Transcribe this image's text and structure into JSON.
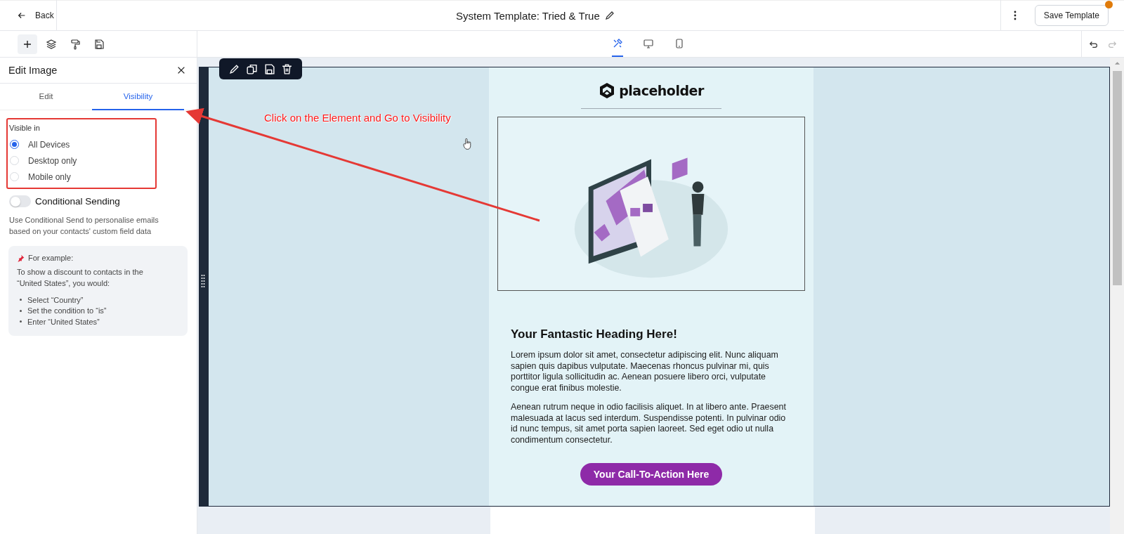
{
  "header": {
    "back": "Back",
    "title": "System Template: Tried & True",
    "save_button": "Save Template",
    "unsaved_changes": true
  },
  "toolbar": {
    "tools": [
      {
        "kind": "add",
        "selected": true
      },
      {
        "kind": "layers",
        "selected": false
      },
      {
        "kind": "paint",
        "selected": false
      },
      {
        "kind": "save",
        "selected": false
      }
    ],
    "views": [
      {
        "kind": "editor",
        "selected": true
      },
      {
        "kind": "desktop",
        "selected": false
      },
      {
        "kind": "mobile",
        "selected": false
      }
    ],
    "history": [
      {
        "kind": "undo",
        "disabled": false
      },
      {
        "kind": "redo",
        "disabled": true
      }
    ]
  },
  "panel": {
    "title": "Edit Image",
    "tabs": [
      {
        "label": "Edit",
        "selected": false
      },
      {
        "label": "Visibility",
        "selected": true
      }
    ],
    "visible_in": {
      "label": "Visible in",
      "options": [
        {
          "label": "All Devices",
          "selected": true
        },
        {
          "label": "Desktop only",
          "selected": false
        },
        {
          "label": "Mobile only",
          "selected": false
        }
      ]
    },
    "conditional": {
      "label": "Conditional Sending",
      "on": false,
      "description": "Use Conditional Send to personalise emails based on your contacts' custom field data"
    },
    "example": {
      "title": "For example:",
      "intro": "To show a discount to contacts in the “United States”, you would:",
      "steps": [
        "Select “Country”",
        "Set the condition to “is”",
        "Enter “United States”"
      ]
    }
  },
  "annotation": {
    "text": "Click on the Element and Go to Visibility"
  },
  "email": {
    "logo": "placeholder",
    "image": {
      "kind": "picture"
    },
    "heading": "Your Fantastic Heading Here!",
    "paragraphs": [
      "Lorem ipsum dolor sit amet, consectetur adipiscing elit. Nunc aliquam sapien quis dapibus vulputate. Maecenas rhoncus pulvinar mi, quis porttitor ligula sollicitudin ac. Aenean posuere libero orci, vulputate congue erat finibus molestie.",
      "Aenean rutrum neque in odio facilisis aliquet. In at libero ante. Praesent malesuada at lacus sed interdum. Suspendisse potenti. In pulvinar odio id nunc tempus, sit amet porta sapien laoreet. Sed eget odio ut nulla condimentum consectetur."
    ],
    "cta": "Your Call-To-Action Here"
  }
}
